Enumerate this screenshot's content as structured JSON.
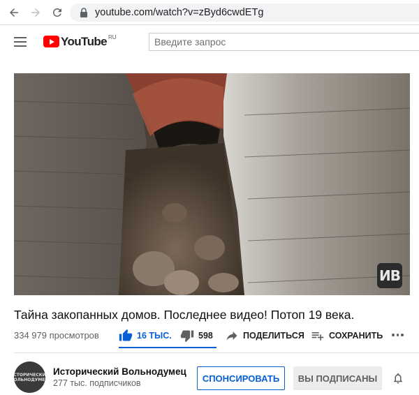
{
  "browser": {
    "url": "youtube.com/watch?v=zByd6cwdETg"
  },
  "header": {
    "logo_text": "YouTube",
    "logo_region": "RU",
    "search_placeholder": "Введите запрос"
  },
  "video": {
    "title": "Тайна закопанных домов. Последнее видео! Потоп 19 века.",
    "watermark": "ИВ",
    "views": "334 979 просмотров"
  },
  "actions": {
    "like_count": "16 ТЫС.",
    "dislike_count": "598",
    "share_label": "ПОДЕЛИТЬСЯ",
    "save_label": "СОХРАНИТЬ"
  },
  "channel": {
    "name": "Исторический Вольнодумец",
    "subscribers": "277 тыс. подписчиков",
    "avatar_text": "ИСТОРИЧЕСКИЙ ВОЛЬНОДУМЕЦ"
  },
  "buttons": {
    "sponsor": "СПОНСИРОВАТЬ",
    "subscribed": "ВЫ ПОДПИСАНЫ"
  },
  "colors": {
    "accent_blue": "#065fd4",
    "brand_red": "#ff0000"
  }
}
